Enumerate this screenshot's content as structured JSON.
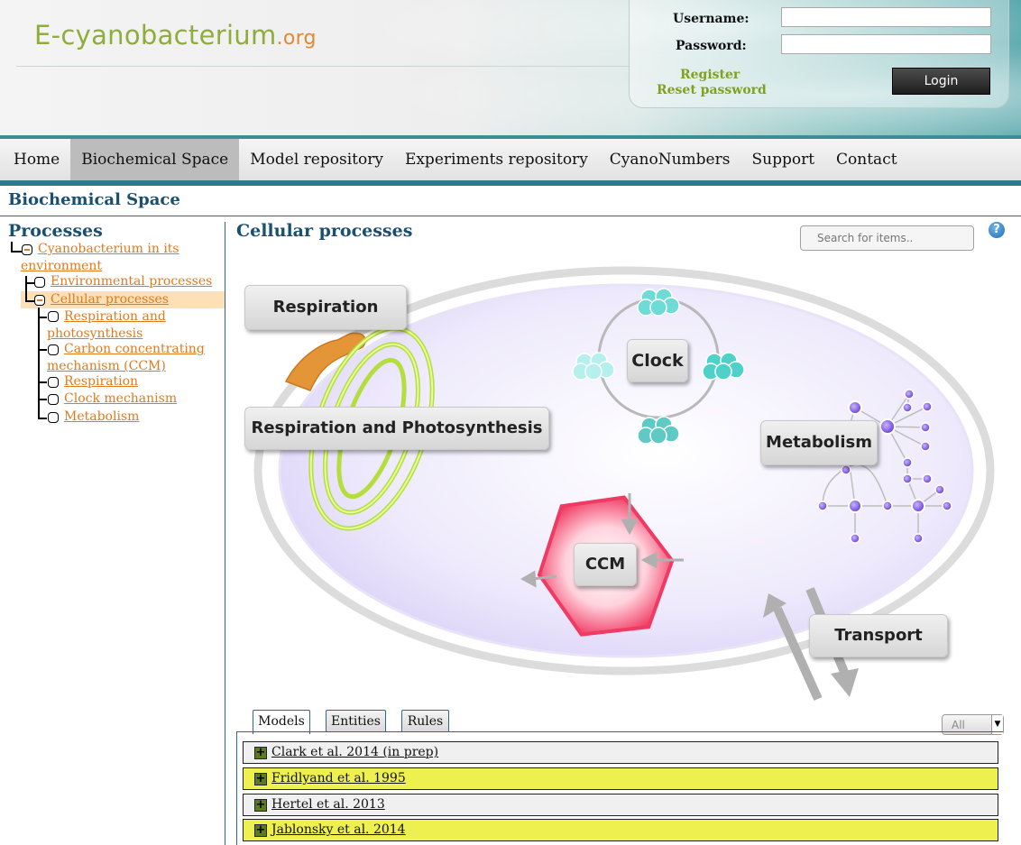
{
  "site": {
    "logo_main": "E-cyanobacterium",
    "logo_suffix": ".org"
  },
  "login": {
    "username_label": "Username:",
    "password_label": "Password:",
    "username_value": "",
    "password_value": "",
    "register_link": "Register",
    "reset_link": "Reset password",
    "login_button": "Login"
  },
  "nav": {
    "items": [
      {
        "label": "Home"
      },
      {
        "label": "Biochemical Space"
      },
      {
        "label": "Model repository"
      },
      {
        "label": "Experiments repository"
      },
      {
        "label": "CyanoNumbers"
      },
      {
        "label": "Support"
      },
      {
        "label": "Contact"
      }
    ],
    "active": "Biochemical Space"
  },
  "page": {
    "title": "Biochemical Space"
  },
  "sidebar": {
    "title": "Processes",
    "tree": {
      "root_line1": "Cyanobacterium in its",
      "root_line2": "environment",
      "env": "Environmental processes",
      "cellular": "Cellular processes",
      "resp_photo_line1": "Respiration and",
      "resp_photo_line2": "photosynthesis",
      "ccm_line1": "Carbon concentrating",
      "ccm_line2": "mechanism (CCM)",
      "respiration": "Respiration",
      "clock": "Clock mechanism",
      "metabolism": "Metabolism"
    }
  },
  "main": {
    "title": "Cellular processes",
    "search_placeholder": "Search for items..",
    "help_icon": "?"
  },
  "diagram": {
    "labels": {
      "respiration": "Respiration",
      "resp_photo": "Respiration and Photosynthesis",
      "clock": "Clock",
      "metabolism": "Metabolism",
      "ccm": "CCM",
      "transport": "Transport"
    },
    "colors": {
      "cell_fill": "#ece6fb",
      "cell_wall": "#dcdcdc",
      "thylakoid": "#c6f05a",
      "respiration_arm": "#e39538",
      "ccm_hex": "#f03a63",
      "clock_cluster": "#6fdbd6",
      "metabolism_node": "#7c4be0"
    }
  },
  "tabs": {
    "items": [
      {
        "label": "Models"
      },
      {
        "label": "Entities"
      },
      {
        "label": "Rules"
      }
    ],
    "active": "Models",
    "filter_value": "All"
  },
  "models": [
    {
      "name": "Clark et al. 2014 (in prep)",
      "highlight": false
    },
    {
      "name": "Fridlyand et al. 1995",
      "highlight": true
    },
    {
      "name": "Hertel et al. 2013",
      "highlight": false
    },
    {
      "name": "Jablonsky et al. 2014",
      "highlight": true
    }
  ]
}
